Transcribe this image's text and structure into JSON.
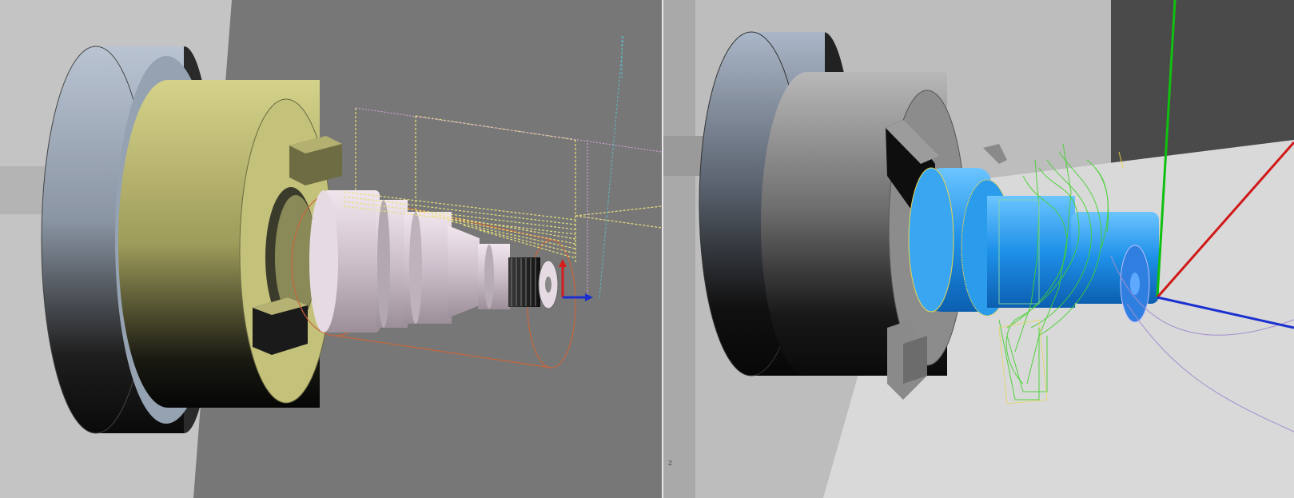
{
  "left_view": {
    "colors": {
      "background_light": "#c4c4c4",
      "background_dark": "#777777",
      "chuck_flange": "#98a6b6",
      "chuck_body": "#c4c27a",
      "jaw": "#a7a46c",
      "workpiece": "#d8cdd6",
      "toolpath": "#e8e07a",
      "stock_outline": "#c8663a",
      "axis_x": "#1a2fd0",
      "axis_y": "#d61c1c"
    },
    "icons": [
      "coordinate-axis-triad-icon"
    ]
  },
  "right_view": {
    "colors": {
      "background": "#bdbdbd",
      "floor": "#d9d9d9",
      "dark_panel": "#4a4a4a",
      "chuck_flange": "#9aaac0",
      "chuck_body": "#8a8a8a",
      "workpiece": "#1e90e8",
      "toolpath": "#44d22e",
      "axis_x": "#1a2fd0",
      "axis_y": "#10c010",
      "axis_z": "#d01818"
    },
    "axis_label": "z",
    "icons": [
      "coordinate-axis-triad-icon"
    ]
  }
}
